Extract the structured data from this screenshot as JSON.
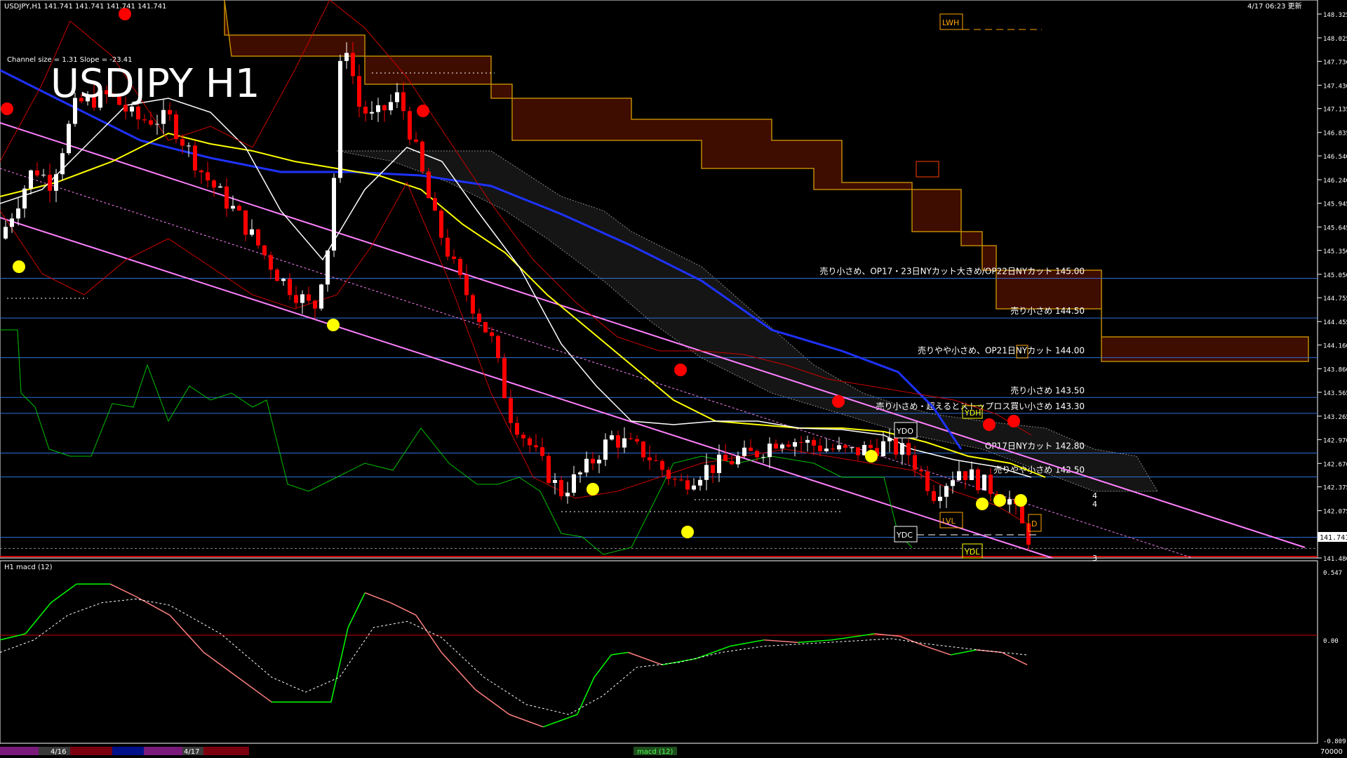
{
  "window": {
    "header_left": "USDJPY,H1  141.741 141.741 141.741 141.741",
    "header_right": "4/17 06:23 更新",
    "title": "USDJPY H1",
    "channel_info": "Channel size = 1.31  Slope = -23.41"
  },
  "colors": {
    "background": "#000000",
    "axis": "#ffffff",
    "bull": "#ffffff",
    "bear": "#ff0000",
    "level_line": "#2f6fd6",
    "channel": "#ff80ff",
    "ma_yellow": "#ffff00",
    "ma_white": "#ffffff",
    "ma_blue": "#0000ff",
    "cloud": "#ff4000",
    "macd_up": "#00ff00",
    "macd_down": "#ff8080",
    "label_box": "#ffa500"
  },
  "chart_data": [
    {
      "type": "line",
      "name": "USDJPY,H1",
      "y_ticks": [
        "148.325",
        "148.025",
        "147.730",
        "147.430",
        "147.135",
        "146.835",
        "146.540",
        "146.240",
        "145.945",
        "145.645",
        "145.350",
        "145.050",
        "144.755",
        "144.455",
        "144.160",
        "143.860",
        "143.565",
        "143.265",
        "142.970",
        "142.670",
        "142.375",
        "142.075",
        "141.480"
      ],
      "ylim": [
        141.48,
        148.325
      ],
      "current_price": "141.741",
      "close_path": [
        [
          0,
          145.5
        ],
        [
          40,
          146.4
        ],
        [
          60,
          146.2
        ],
        [
          90,
          147.2
        ],
        [
          130,
          147.3
        ],
        [
          160,
          147.0
        ],
        [
          200,
          147.0
        ],
        [
          240,
          146.3
        ],
        [
          280,
          145.8
        ],
        [
          330,
          145.0
        ],
        [
          370,
          144.6
        ],
        [
          390,
          145.6
        ],
        [
          400,
          147.6
        ],
        [
          410,
          148.0
        ],
        [
          420,
          147.2
        ],
        [
          440,
          147.0
        ],
        [
          470,
          147.3
        ],
        [
          490,
          146.6
        ],
        [
          510,
          145.8
        ],
        [
          540,
          145.0
        ],
        [
          580,
          144.2
        ],
        [
          600,
          143.3
        ],
        [
          630,
          142.8
        ],
        [
          660,
          142.3
        ],
        [
          690,
          142.6
        ],
        [
          720,
          143.0
        ],
        [
          760,
          142.8
        ],
        [
          800,
          142.4
        ],
        [
          830,
          142.6
        ],
        [
          860,
          142.7
        ],
        [
          890,
          142.8
        ],
        [
          920,
          143.0
        ],
        [
          960,
          142.9
        ],
        [
          1000,
          142.8
        ],
        [
          1040,
          142.9
        ],
        [
          1070,
          142.8
        ],
        [
          1100,
          142.3
        ],
        [
          1130,
          142.6
        ],
        [
          1160,
          142.4
        ],
        [
          1190,
          142.2
        ],
        [
          1210,
          141.74
        ]
      ],
      "level_lines": [
        {
          "price": 145.0,
          "label": "売り小さめ、OP17・23日NYカット大きめ/OP22日NYカット 145.00"
        },
        {
          "price": 144.5,
          "label": "売り小さめ 144.50"
        },
        {
          "price": 144.0,
          "label": "売りやや小さめ、OP21日NYカット 144.00"
        },
        {
          "price": 143.5,
          "label": "売り小さめ 143.50"
        },
        {
          "price": 143.3,
          "label": "売り小さめ・超えるとストップロス買い小さめ 143.30"
        },
        {
          "price": 142.8,
          "label": "OP17日NYカット 142.80"
        },
        {
          "price": 142.5,
          "label": "売りやや小さめ 142.50"
        }
      ],
      "markers": [
        "LWH",
        "LWL",
        "YDH",
        "YDO",
        "YDC",
        "YDL",
        "LVL",
        "D",
        "W"
      ],
      "right_labels": [
        "4",
        "4",
        "3"
      ]
    },
    {
      "type": "line",
      "name": "H1  macd (12)",
      "y_ticks": [
        "0.547",
        "0.00",
        "-0.809"
      ],
      "ylim": [
        -0.809,
        0.547
      ],
      "macd_main": [
        [
          0,
          0.0
        ],
        [
          30,
          0.05
        ],
        [
          60,
          0.3
        ],
        [
          90,
          0.45
        ],
        [
          130,
          0.45
        ],
        [
          160,
          0.35
        ],
        [
          200,
          0.2
        ],
        [
          240,
          -0.1
        ],
        [
          280,
          -0.3
        ],
        [
          320,
          -0.5
        ],
        [
          360,
          -0.5
        ],
        [
          390,
          -0.5
        ],
        [
          410,
          0.1
        ],
        [
          430,
          0.38
        ],
        [
          460,
          0.3
        ],
        [
          490,
          0.2
        ],
        [
          520,
          -0.1
        ],
        [
          560,
          -0.4
        ],
        [
          600,
          -0.6
        ],
        [
          640,
          -0.7
        ],
        [
          680,
          -0.6
        ],
        [
          700,
          -0.3
        ],
        [
          720,
          -0.12
        ],
        [
          740,
          -0.1
        ],
        [
          780,
          -0.2
        ],
        [
          820,
          -0.15
        ],
        [
          860,
          -0.05
        ],
        [
          900,
          0.0
        ],
        [
          940,
          -0.02
        ],
        [
          980,
          0.0
        ],
        [
          1030,
          0.05
        ],
        [
          1060,
          0.03
        ],
        [
          1090,
          -0.05
        ],
        [
          1120,
          -0.12
        ],
        [
          1150,
          -0.08
        ],
        [
          1180,
          -0.1
        ],
        [
          1210,
          -0.2
        ]
      ],
      "macd_signal": [
        [
          0,
          -0.1
        ],
        [
          40,
          0.0
        ],
        [
          80,
          0.2
        ],
        [
          120,
          0.3
        ],
        [
          160,
          0.33
        ],
        [
          200,
          0.28
        ],
        [
          260,
          0.05
        ],
        [
          320,
          -0.3
        ],
        [
          360,
          -0.42
        ],
        [
          400,
          -0.3
        ],
        [
          440,
          0.1
        ],
        [
          480,
          0.15
        ],
        [
          520,
          0.02
        ],
        [
          570,
          -0.3
        ],
        [
          620,
          -0.52
        ],
        [
          670,
          -0.6
        ],
        [
          710,
          -0.45
        ],
        [
          750,
          -0.22
        ],
        [
          800,
          -0.18
        ],
        [
          850,
          -0.1
        ],
        [
          900,
          -0.05
        ],
        [
          950,
          -0.03
        ],
        [
          1000,
          -0.01
        ],
        [
          1050,
          0.01
        ],
        [
          1090,
          -0.03
        ],
        [
          1140,
          -0.07
        ],
        [
          1180,
          -0.1
        ],
        [
          1210,
          -0.12
        ]
      ]
    }
  ],
  "bottom_bar": {
    "date_labels": [
      "4/16",
      "4/17"
    ],
    "indicator_label": "macd (12)",
    "volume_label": "70000"
  }
}
